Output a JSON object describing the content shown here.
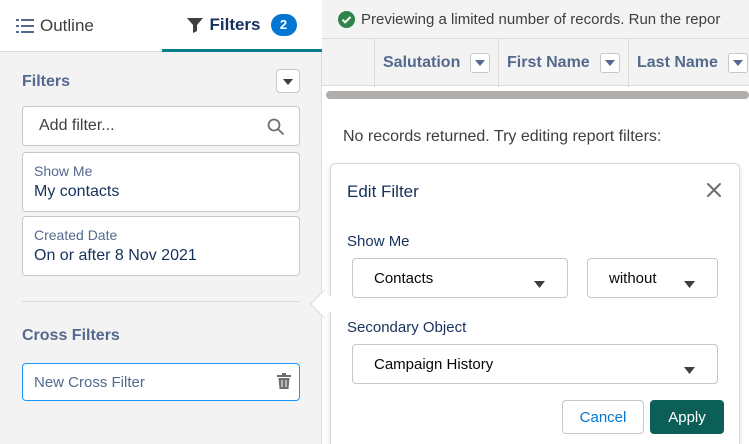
{
  "tabs": {
    "outline": "Outline",
    "filters": "Filters",
    "filters_count": "2"
  },
  "filters_panel": {
    "title": "Filters",
    "search_placeholder": "Add filter...",
    "filters": [
      {
        "label": "Show Me",
        "value": "My contacts"
      },
      {
        "label": "Created Date",
        "value": "On or after 8 Nov 2021"
      }
    ],
    "cross_title": "Cross Filters",
    "cross_item": "New Cross Filter"
  },
  "banner": {
    "text": "Previewing a limited number of records. Run the repor"
  },
  "table": {
    "columns": [
      "Salutation",
      "First Name",
      "Last Name"
    ]
  },
  "empty_message": "No records returned. Try editing report filters:",
  "edit_filter": {
    "title": "Edit Filter",
    "show_me_label": "Show Me",
    "show_me_value": "Contacts",
    "operator_value": "without",
    "secondary_label": "Secondary Object",
    "secondary_value": "Campaign History",
    "cancel": "Cancel",
    "apply": "Apply"
  },
  "colors": {
    "accent_tab": "#0b7c8c",
    "badge": "#0176d3",
    "apply": "#0b5f56",
    "success": "#2e844a"
  }
}
